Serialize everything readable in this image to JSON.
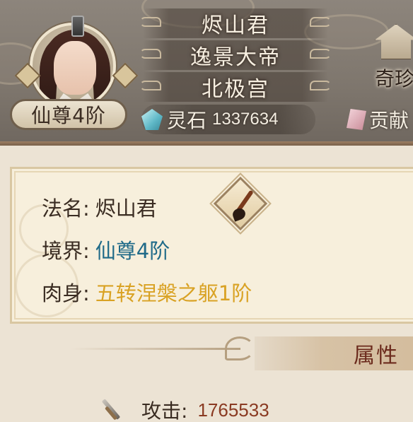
{
  "header": {
    "rank_badge": "仙尊4阶",
    "banners": [
      "烬山君",
      "逸景大帝",
      "北极宫"
    ],
    "spirit_stone": {
      "label": "灵石",
      "value": "1337634",
      "icon": "gem-icon"
    },
    "contribution": {
      "label": "贡献",
      "icon": "token-icon"
    },
    "treasure": {
      "label": "奇珍",
      "icon": "pavilion-icon"
    }
  },
  "info": {
    "name_label": "法名:",
    "name_value": "烬山君",
    "realm_label": "境界:",
    "realm_value": "仙尊4阶",
    "body_label": "肉身:",
    "body_value": "五转涅槃之躯1阶",
    "rename_icon": "brush-icon"
  },
  "section": {
    "title": "属性"
  },
  "stats": {
    "attack_label": "攻击:",
    "attack_value": "1765533",
    "attack_icon": "sword-icon"
  },
  "colors": {
    "realm": "#1f6a88",
    "body": "#d9a224",
    "attack_value": "#8a3a22",
    "section_title": "#6b2a1c"
  }
}
